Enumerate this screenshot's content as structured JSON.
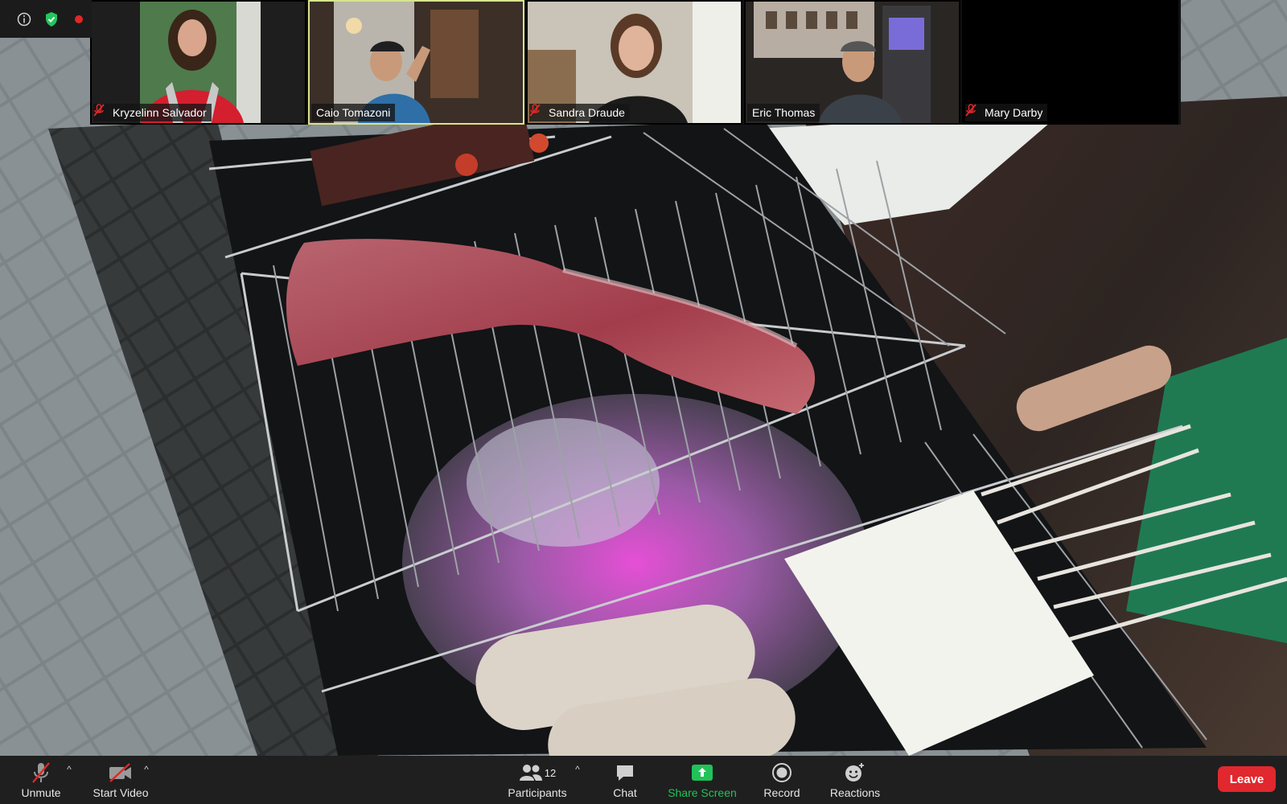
{
  "app": {
    "title": "Zoom Meeting"
  },
  "status_bar": {
    "icons": [
      "info-icon",
      "shield-check-icon",
      "recording-dot-icon"
    ],
    "shield_color": "#23c55e",
    "recording_color": "#e02828"
  },
  "participants_gallery": [
    {
      "name": "Kryzelinn Salvador",
      "muted": true,
      "active": false
    },
    {
      "name": "Caio Tomazoni",
      "muted": false,
      "active": true
    },
    {
      "name": "Sandra Draude",
      "muted": true,
      "active": false
    },
    {
      "name": "Eric Thomas",
      "muted": false,
      "active": false
    },
    {
      "name": "Mary Darby",
      "muted": true,
      "active": false
    }
  ],
  "toolbar": {
    "unmute_label": "Unmute",
    "start_video_label": "Start Video",
    "participants_label": "Participants",
    "participants_count": "12",
    "chat_label": "Chat",
    "share_screen_label": "Share Screen",
    "record_label": "Record",
    "reactions_label": "Reactions",
    "leave_label": "Leave",
    "share_color": "#22c25a",
    "leave_color": "#e0282e",
    "active_speaker_border": "#d7e58a"
  }
}
